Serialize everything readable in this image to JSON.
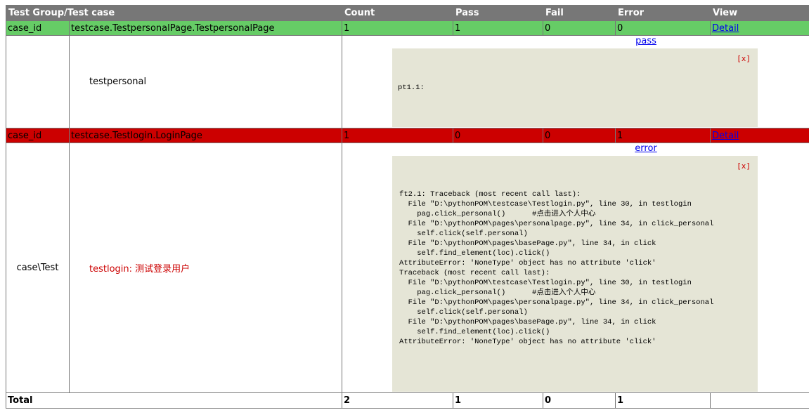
{
  "header": {
    "group": "Test Group/Test case",
    "count": "Count",
    "pass": "Pass",
    "fail": "Fail",
    "error": "Error",
    "view": "View"
  },
  "groups": [
    {
      "id": "case_id",
      "name": "testcase.TestpersonalPage.TestpersonalPage",
      "count": "1",
      "pass": "1",
      "fail": "0",
      "error": "0",
      "detail": "Detail",
      "status_color": "#66cc66",
      "test": {
        "label": "",
        "name": "testpersonal",
        "result_link": "pass",
        "close": "[x]",
        "log": "pt1.1:"
      }
    },
    {
      "id": "case_id",
      "name": "testcase.Testlogin.LoginPage",
      "count": "1",
      "pass": "0",
      "fail": "0",
      "error": "1",
      "detail": "Detail",
      "status_color": "#cc0000",
      "test": {
        "label": "case\\Test",
        "name": "testlogin: 测试登录用户",
        "result_link": "error",
        "close": "[x]",
        "log": "ft2.1: Traceback (most recent call last):\n  File \"D:\\pythonPOM\\testcase\\Testlogin.py\", line 30, in testlogin\n    pag.click_personal()      #点击进入个人中心\n  File \"D:\\pythonPOM\\pages\\personalpage.py\", line 34, in click_personal\n    self.click(self.personal)\n  File \"D:\\pythonPOM\\pages\\basePage.py\", line 34, in click\n    self.find_element(loc).click()\nAttributeError: 'NoneType' object has no attribute 'click'\nTraceback (most recent call last):\n  File \"D:\\pythonPOM\\testcase\\Testlogin.py\", line 30, in testlogin\n    pag.click_personal()      #点击进入个人中心\n  File \"D:\\pythonPOM\\pages\\personalpage.py\", line 34, in click_personal\n    self.click(self.personal)\n  File \"D:\\pythonPOM\\pages\\basePage.py\", line 34, in click\n    self.find_element(loc).click()\nAttributeError: 'NoneType' object has no attribute 'click'"
      }
    }
  ],
  "total": {
    "label": "Total",
    "count": "2",
    "pass": "1",
    "fail": "0",
    "error": "1",
    "view": ""
  }
}
